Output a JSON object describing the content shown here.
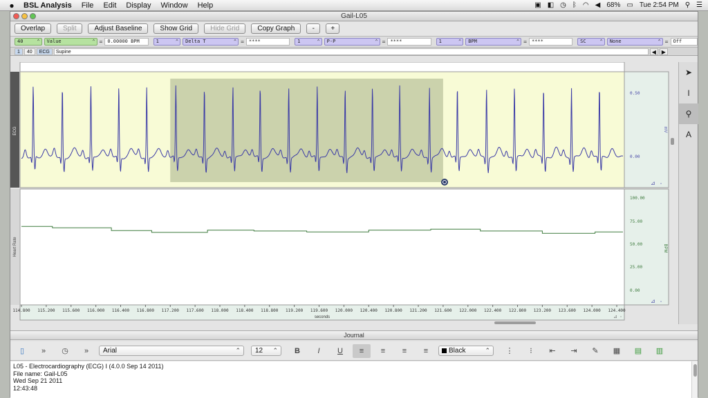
{
  "menubar": {
    "app": "BSL Analysis",
    "items": [
      "File",
      "Edit",
      "Display",
      "Window",
      "Help"
    ],
    "battery": "68%",
    "clock": "Tue 2:54 PM"
  },
  "window": {
    "title": "Gail-L05"
  },
  "toolbar": {
    "overlap": "Overlap",
    "split": "Split",
    "adjust_baseline": "Adjust Baseline",
    "show_grid": "Show Grid",
    "hide_grid": "Hide Grid",
    "copy_graph": "Copy Graph",
    "zoom_out": "-",
    "zoom_in": "+"
  },
  "measurements": [
    {
      "channel": "40",
      "type": "Value",
      "value": "0.00000 BPM"
    },
    {
      "channel": "1",
      "type": "Delta T",
      "value": "****"
    },
    {
      "channel": "1",
      "type": "P-P",
      "value": "****"
    },
    {
      "channel": "1",
      "type": "BPM",
      "value": "****"
    },
    {
      "channel": "SC",
      "type": "None",
      "value": "Off"
    }
  ],
  "channel_tabs": {
    "ch1": "1",
    "ch40": "40",
    "ecg": "ECG",
    "label": "Supine"
  },
  "graph": {
    "ecg_label": "ECG",
    "ecg_unit": "mV",
    "ecg_ticks": [
      "0.50",
      "0.00"
    ],
    "hr_label": "Heart Rate",
    "hr_unit": "BPM",
    "hr_ticks": [
      "100.00",
      "75.00",
      "50.00",
      "25.00",
      "0.00"
    ],
    "xlabel": "seconds",
    "x_ticks": [
      "114.800",
      "115.200",
      "115.600",
      "116.000",
      "116.400",
      "116.800",
      "117.200",
      "117.600",
      "118.000",
      "118.400",
      "118.800",
      "119.200",
      "119.600",
      "120.000",
      "120.400",
      "120.800",
      "121.200",
      "121.600",
      "122.000",
      "122.400",
      "122.800",
      "123.200",
      "123.600",
      "124.000",
      "124.400"
    ],
    "selection_seconds": [
      117.2,
      121.6
    ]
  },
  "chart_data": {
    "type": "line",
    "xlabel": "seconds",
    "xlim": [
      114.8,
      124.5
    ],
    "series": [
      {
        "name": "ECG",
        "unit": "mV",
        "ylim": [
          -0.1,
          0.6
        ],
        "r_peak_times": [
          114.99,
          115.46,
          115.92,
          116.37,
          116.82,
          117.29,
          117.75,
          118.21,
          118.65,
          119.11,
          119.57,
          120.02,
          120.46,
          120.9,
          121.38,
          121.83,
          122.3,
          122.75,
          123.22,
          123.67,
          124.12
        ],
        "baseline": 0.0,
        "r_amplitude": 0.55
      },
      {
        "name": "Heart Rate",
        "unit": "BPM",
        "ylim": [
          0,
          100
        ],
        "steps": [
          [
            114.8,
            73.5
          ],
          [
            115.3,
            72.0
          ],
          [
            116.25,
            69.0
          ],
          [
            116.9,
            67.0
          ],
          [
            117.8,
            69.5
          ],
          [
            118.55,
            68.5
          ],
          [
            119.4,
            67.5
          ],
          [
            120.4,
            69.5
          ],
          [
            121.4,
            70.5
          ],
          [
            122.2,
            68.5
          ],
          [
            123.2,
            66.0
          ],
          [
            124.05,
            67.5
          ]
        ]
      }
    ]
  },
  "journal": {
    "title": "Journal",
    "font": "Arial",
    "size": "12",
    "color": "Black",
    "lines": [
      "L05 - Electrocardiography (ECG) I (4.0.0 Sep 14 2011)",
      "File name: Gail-L05",
      "Wed Sep 21 2011",
      "12:43:48"
    ]
  }
}
